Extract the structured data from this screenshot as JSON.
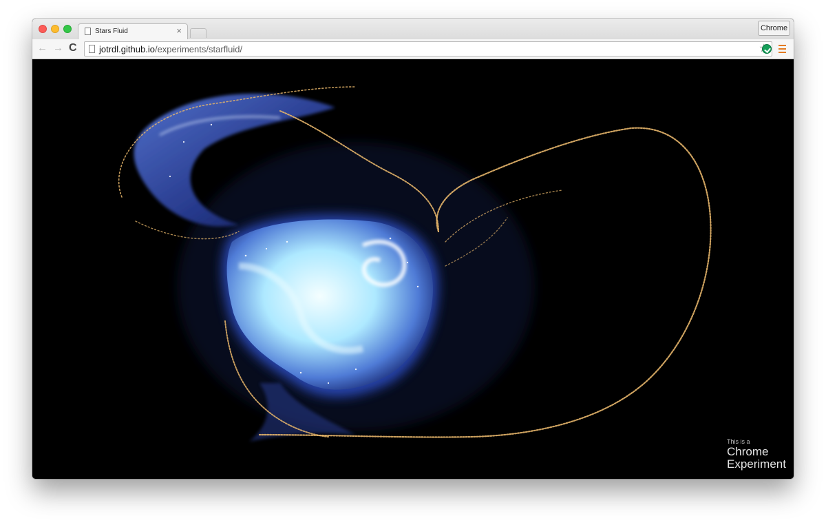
{
  "window": {
    "tab_title": "Stars Fluid",
    "tab_close": "×",
    "profile_button": "Chrome"
  },
  "toolbar": {
    "back": "←",
    "forward": "→",
    "reload": "C",
    "url_host": "jotrdl.github.io",
    "url_path": "/experiments/starfluid/",
    "star": "☆"
  },
  "page": {
    "background": "#000000",
    "fluid_colors": {
      "core": "#e6fbff",
      "mid": "#4f7bd6",
      "glow": "#1c2f7a",
      "sparkle": "#e6b56a"
    },
    "badge_line1": "This is a",
    "badge_line2": "Chrome",
    "badge_line3": "Experiment"
  }
}
